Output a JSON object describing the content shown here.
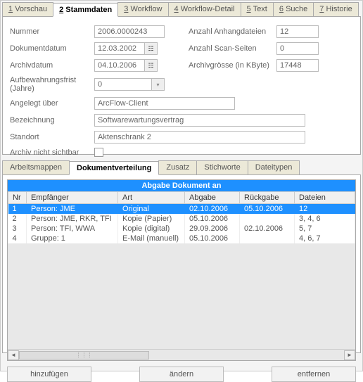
{
  "topTabs": [
    {
      "num": "1",
      "label": "Vorschau"
    },
    {
      "num": "2",
      "label": "Stammdaten",
      "active": true
    },
    {
      "num": "3",
      "label": "Workflow"
    },
    {
      "num": "4",
      "label": "Workflow-Detail"
    },
    {
      "num": "5",
      "label": "Text"
    },
    {
      "num": "6",
      "label": "Suche"
    },
    {
      "num": "7",
      "label": "Historie"
    }
  ],
  "form": {
    "nummer_lbl": "Nummer",
    "nummer": "2006.0000243",
    "dokdatum_lbl": "Dokumentdatum",
    "dokdatum": "12.03.2002",
    "archivdatum_lbl": "Archivdatum",
    "archivdatum": "04.10.2006",
    "aufbewahr_lbl": "Aufbewahrungsfrist (Jahre)",
    "aufbewahr": "0",
    "angelegt_lbl": "Angelegt über",
    "angelegt": "ArcFlow-Client",
    "bezeichnung_lbl": "Bezeichnung",
    "bezeichnung": "Softwarewartungsvertrag",
    "standort_lbl": "Standort",
    "standort": "Aktenschrank 2",
    "archiv_nicht_sichtbar_lbl": "Archiv nicht sichtbar",
    "anz_anhang_lbl": "Anzahl Anhangdateien",
    "anz_anhang": "12",
    "anz_scan_lbl": "Anzahl Scan-Seiten",
    "anz_scan": "0",
    "archivgroesse_lbl": "Archivgrösse (in KByte)",
    "archivgroesse": "17448"
  },
  "subTabs": [
    {
      "label": "Arbeitsmappen"
    },
    {
      "label": "Dokumentverteilung",
      "active": true
    },
    {
      "label": "Zusatz"
    },
    {
      "label": "Stichworte"
    },
    {
      "label": "Dateitypen"
    }
  ],
  "table": {
    "title": "Abgabe Dokument an",
    "cols": [
      "Nr",
      "Empfänger",
      "Art",
      "Abgabe",
      "Rückgabe",
      "Dateien"
    ],
    "rows": [
      {
        "nr": "1",
        "empf": "Person: JME",
        "art": "Original",
        "abgabe": "02.10.2006",
        "rueck": "05.10.2006",
        "dateien": "12",
        "sel": true
      },
      {
        "nr": "2",
        "empf": "Person: JME, RKR, TFI",
        "art": "Kopie (Papier)",
        "abgabe": "05.10.2006",
        "rueck": "",
        "dateien": "3, 4, 6"
      },
      {
        "nr": "3",
        "empf": "Person: TFI, WWA",
        "art": "Kopie (digital)",
        "abgabe": "29.09.2006",
        "rueck": "02.10.2006",
        "dateien": "5, 7"
      },
      {
        "nr": "4",
        "empf": "Gruppe: 1",
        "art": "E-Mail (manuell)",
        "abgabe": "05.10.2006",
        "rueck": "",
        "dateien": "4, 6, 7"
      }
    ]
  },
  "buttons": {
    "add": "hinzufügen",
    "edit": "ändern",
    "remove": "entfernen"
  }
}
